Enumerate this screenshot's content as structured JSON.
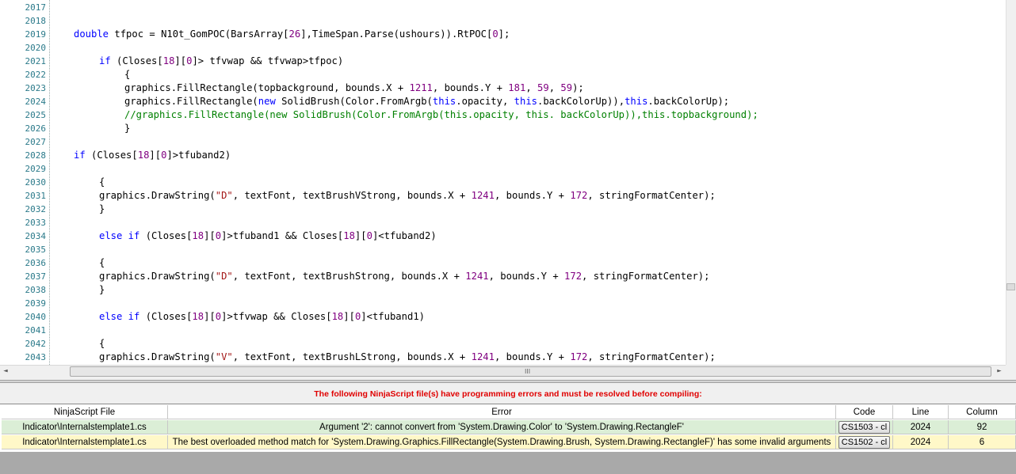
{
  "editor": {
    "lines": [
      {
        "n": "2017",
        "indent": 0,
        "tokens": []
      },
      {
        "n": "2018",
        "indent": 0,
        "tokens": []
      },
      {
        "n": "2019",
        "indent": 1,
        "tokens": [
          [
            "kw",
            "double"
          ],
          [
            "t",
            " tfpoc = N10t_GomPOC(BarsArray["
          ],
          [
            "num",
            "26"
          ],
          [
            "t",
            "],TimeSpan.Parse(ushours)).RtPOC["
          ],
          [
            "num",
            "0"
          ],
          [
            "t",
            "];"
          ]
        ]
      },
      {
        "n": "2020",
        "indent": 0,
        "tokens": []
      },
      {
        "n": "2021",
        "indent": 2,
        "tokens": [
          [
            "kw",
            "if"
          ],
          [
            "t",
            " (Closes["
          ],
          [
            "num",
            "18"
          ],
          [
            "t",
            "]["
          ],
          [
            "num",
            "0"
          ],
          [
            "t",
            "]> tfvwap && tfvwap>tfpoc)"
          ]
        ]
      },
      {
        "n": "2022",
        "indent": 3,
        "tokens": [
          [
            "t",
            "{"
          ]
        ]
      },
      {
        "n": "2023",
        "indent": 3,
        "tokens": [
          [
            "t",
            "graphics.FillRectangle(topbackground, bounds.X + "
          ],
          [
            "num",
            "1211"
          ],
          [
            "t",
            ", bounds.Y + "
          ],
          [
            "num",
            "181"
          ],
          [
            "t",
            ", "
          ],
          [
            "num",
            "59"
          ],
          [
            "t",
            ", "
          ],
          [
            "num",
            "59"
          ],
          [
            "t",
            ");"
          ]
        ]
      },
      {
        "n": "2024",
        "indent": 3,
        "tokens": [
          [
            "t",
            "graphics.FillRectangle("
          ],
          [
            "kw",
            "new"
          ],
          [
            "t",
            " SolidBrush(Color.FromArgb("
          ],
          [
            "kw",
            "this"
          ],
          [
            "t",
            ".opacity, "
          ],
          [
            "kw",
            "this"
          ],
          [
            "t",
            ".backColorUp)),"
          ],
          [
            "kw",
            "this"
          ],
          [
            "t",
            ".backColorUp);"
          ]
        ]
      },
      {
        "n": "2025",
        "indent": 3,
        "tokens": [
          [
            "cm",
            "//graphics.FillRectangle(new SolidBrush(Color.FromArgb(this.opacity, this. backColorUp)),this.topbackground);"
          ]
        ]
      },
      {
        "n": "2026",
        "indent": 3,
        "tokens": [
          [
            "t",
            "}"
          ]
        ]
      },
      {
        "n": "2027",
        "indent": 0,
        "tokens": []
      },
      {
        "n": "2028",
        "indent": 1,
        "tokens": [
          [
            "kw",
            "if"
          ],
          [
            "t",
            " (Closes["
          ],
          [
            "num",
            "18"
          ],
          [
            "t",
            "]["
          ],
          [
            "num",
            "0"
          ],
          [
            "t",
            "]>tfuband2)"
          ]
        ]
      },
      {
        "n": "2029",
        "indent": 0,
        "tokens": []
      },
      {
        "n": "2030",
        "indent": 2,
        "tokens": [
          [
            "t",
            "{"
          ]
        ]
      },
      {
        "n": "2031",
        "indent": 2,
        "tokens": [
          [
            "t",
            "graphics.DrawString("
          ],
          [
            "str",
            "\"D\""
          ],
          [
            "t",
            ", textFont, textBrushVStrong, bounds.X + "
          ],
          [
            "num",
            "1241"
          ],
          [
            "t",
            ", bounds.Y + "
          ],
          [
            "num",
            "172"
          ],
          [
            "t",
            ", stringFormatCenter);"
          ]
        ]
      },
      {
        "n": "2032",
        "indent": 2,
        "tokens": [
          [
            "t",
            "}"
          ]
        ]
      },
      {
        "n": "2033",
        "indent": 0,
        "tokens": []
      },
      {
        "n": "2034",
        "indent": 2,
        "tokens": [
          [
            "kw",
            "else if"
          ],
          [
            "t",
            " (Closes["
          ],
          [
            "num",
            "18"
          ],
          [
            "t",
            "]["
          ],
          [
            "num",
            "0"
          ],
          [
            "t",
            "]>tfuband1 && Closes["
          ],
          [
            "num",
            "18"
          ],
          [
            "t",
            "]["
          ],
          [
            "num",
            "0"
          ],
          [
            "t",
            "]<tfuband2)"
          ]
        ]
      },
      {
        "n": "2035",
        "indent": 0,
        "tokens": []
      },
      {
        "n": "2036",
        "indent": 2,
        "tokens": [
          [
            "t",
            "{"
          ]
        ]
      },
      {
        "n": "2037",
        "indent": 2,
        "tokens": [
          [
            "t",
            "graphics.DrawString("
          ],
          [
            "str",
            "\"D\""
          ],
          [
            "t",
            ", textFont, textBrushStrong, bounds.X + "
          ],
          [
            "num",
            "1241"
          ],
          [
            "t",
            ", bounds.Y + "
          ],
          [
            "num",
            "172"
          ],
          [
            "t",
            ", stringFormatCenter);"
          ]
        ]
      },
      {
        "n": "2038",
        "indent": 2,
        "tokens": [
          [
            "t",
            "}"
          ]
        ]
      },
      {
        "n": "2039",
        "indent": 0,
        "tokens": []
      },
      {
        "n": "2040",
        "indent": 2,
        "tokens": [
          [
            "kw",
            "else if"
          ],
          [
            "t",
            " (Closes["
          ],
          [
            "num",
            "18"
          ],
          [
            "t",
            "]["
          ],
          [
            "num",
            "0"
          ],
          [
            "t",
            "]>tfvwap && Closes["
          ],
          [
            "num",
            "18"
          ],
          [
            "t",
            "]["
          ],
          [
            "num",
            "0"
          ],
          [
            "t",
            "]<tfuband1)"
          ]
        ]
      },
      {
        "n": "2041",
        "indent": 0,
        "tokens": []
      },
      {
        "n": "2042",
        "indent": 2,
        "tokens": [
          [
            "t",
            "{"
          ]
        ]
      },
      {
        "n": "2043",
        "indent": 2,
        "tokens": [
          [
            "t",
            "graphics.DrawString("
          ],
          [
            "str",
            "\"V\""
          ],
          [
            "t",
            ", textFont, textBrushLStrong, bounds.X + "
          ],
          [
            "num",
            "1241"
          ],
          [
            "t",
            ", bounds.Y + "
          ],
          [
            "num",
            "172"
          ],
          [
            "t",
            ", stringFormatCenter);"
          ]
        ]
      }
    ]
  },
  "scrollbar": {
    "left_arrow": "◄",
    "right_arrow": "►",
    "grip": "III"
  },
  "errors_panel": {
    "banner": "The following NinjaScript file(s) have programming errors and must be resolved before compiling:",
    "columns": {
      "file": "NinjaScript File",
      "error": "Error",
      "code": "Code",
      "line": "Line",
      "column": "Column"
    },
    "rows": [
      {
        "file": "Indicator\\Internalstemplate1.cs",
        "error": "Argument '2': cannot convert from 'System.Drawing.Color' to 'System.Drawing.RectangleF'",
        "code": "CS1503 - cl",
        "line": "2024",
        "column": "92"
      },
      {
        "file": "Indicator\\Internalstemplate1.cs",
        "error": "The best overloaded method match for 'System.Drawing.Graphics.FillRectangle(System.Drawing.Brush, System.Drawing.RectangleF)' has some invalid arguments",
        "code": "CS1502 - cl",
        "line": "2024",
        "column": "6"
      }
    ]
  },
  "colors": {
    "keyword": "#0000ff",
    "number": "#800080",
    "string": "#a31515",
    "comment": "#008000",
    "banner": "#e00000",
    "row1": "#dbeed6",
    "row2": "#fff8c8"
  }
}
